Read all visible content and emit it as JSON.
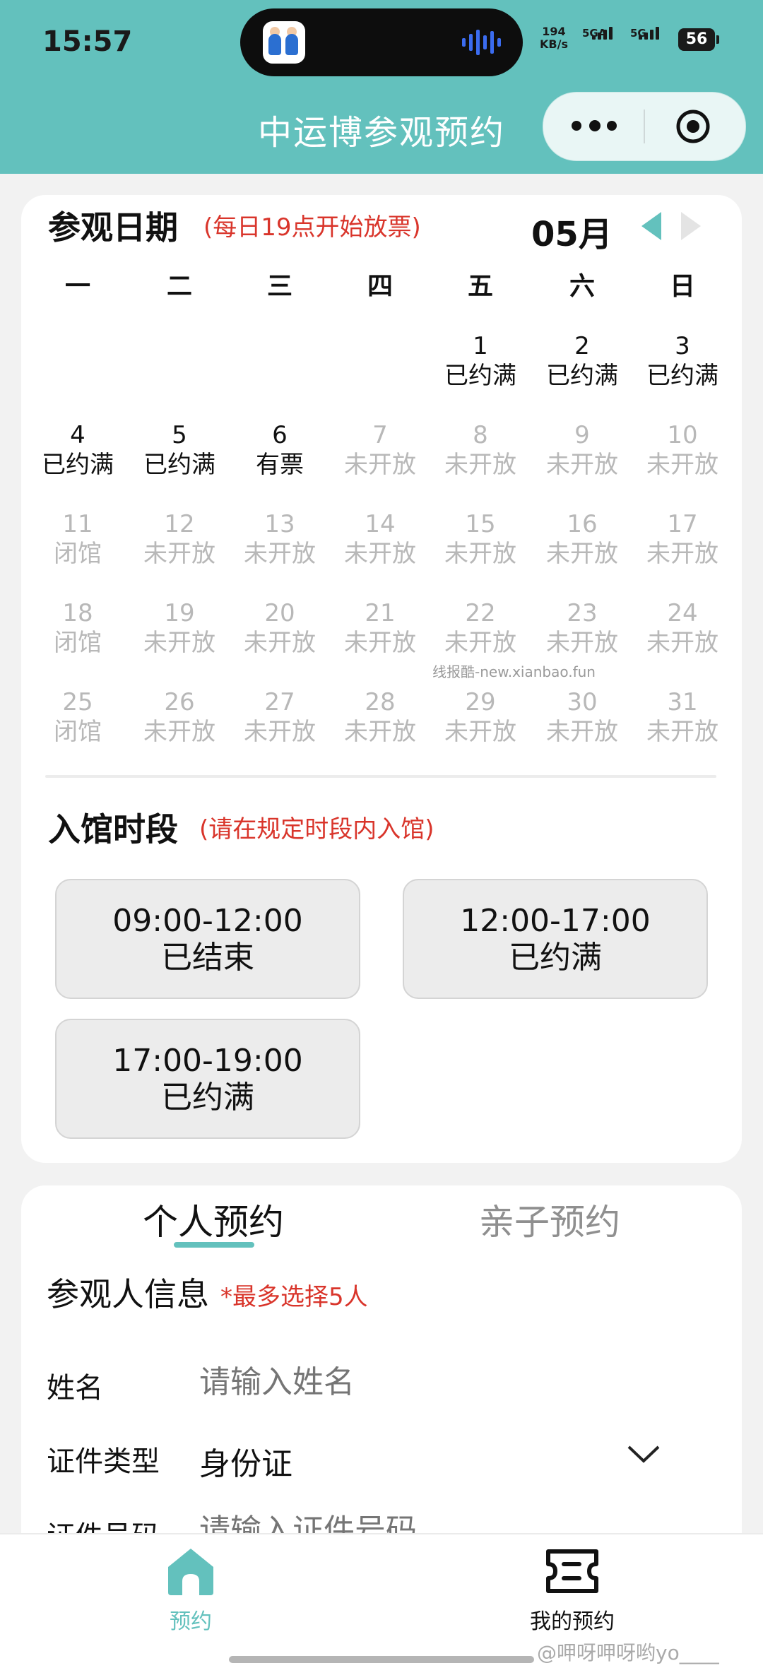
{
  "status_bar": {
    "time": "15:57",
    "net_speed_value": "194",
    "net_speed_unit": "KB/s",
    "sim1": "5GA",
    "sim2": "5G",
    "battery": "56"
  },
  "header": {
    "title": "中运博参观预约"
  },
  "date_section": {
    "title": "参观日期",
    "note": "(每日19点开始放票)",
    "month": "05月",
    "weekdays": [
      "一",
      "二",
      "三",
      "四",
      "五",
      "六",
      "日"
    ],
    "days": [
      {
        "day": "1",
        "status": "已约满"
      },
      {
        "day": "2",
        "status": "已约满"
      },
      {
        "day": "3",
        "status": "已约满"
      },
      {
        "day": "4",
        "status": "已约满"
      },
      {
        "day": "5",
        "status": "已约满"
      },
      {
        "day": "6",
        "status": "有票"
      },
      {
        "day": "7",
        "status": "未开放"
      },
      {
        "day": "8",
        "status": "未开放"
      },
      {
        "day": "9",
        "status": "未开放"
      },
      {
        "day": "10",
        "status": "未开放"
      },
      {
        "day": "11",
        "status": "闭馆"
      },
      {
        "day": "12",
        "status": "未开放"
      },
      {
        "day": "13",
        "status": "未开放"
      },
      {
        "day": "14",
        "status": "未开放"
      },
      {
        "day": "15",
        "status": "未开放"
      },
      {
        "day": "16",
        "status": "未开放"
      },
      {
        "day": "17",
        "status": "未开放"
      },
      {
        "day": "18",
        "status": "闭馆"
      },
      {
        "day": "19",
        "status": "未开放"
      },
      {
        "day": "20",
        "status": "未开放"
      },
      {
        "day": "21",
        "status": "未开放"
      },
      {
        "day": "22",
        "status": "未开放"
      },
      {
        "day": "23",
        "status": "未开放"
      },
      {
        "day": "24",
        "status": "未开放"
      },
      {
        "day": "25",
        "status": "闭馆"
      },
      {
        "day": "26",
        "status": "未开放"
      },
      {
        "day": "27",
        "status": "未开放"
      },
      {
        "day": "28",
        "status": "未开放"
      },
      {
        "day": "29",
        "status": "未开放"
      },
      {
        "day": "30",
        "status": "未开放"
      },
      {
        "day": "31",
        "status": "未开放"
      }
    ],
    "watermark": "线报酷-new.xianbao.fun"
  },
  "time_section": {
    "title": "入馆时段",
    "note": "(请在规定时段内入馆)",
    "slots": [
      {
        "time": "09:00-12:00",
        "status": "已结束"
      },
      {
        "time": "12:00-17:00",
        "status": "已约满"
      },
      {
        "time": "17:00-19:00",
        "status": "已约满"
      }
    ]
  },
  "booking": {
    "tabs": [
      "个人预约",
      "亲子预约"
    ],
    "visitor_title": "参观人信息",
    "visitor_note": "*最多选择5人",
    "name_label": "姓名",
    "name_placeholder": "请输入姓名",
    "id_type_label": "证件类型",
    "id_type_value": "身份证",
    "id_number_label": "证件号码",
    "id_number_placeholder": "请输入证件号码"
  },
  "tabbar": {
    "home_label": "预约",
    "mine_label": "我的预约"
  },
  "weibo_watermark": "@呷呀呷呀哟yo____",
  "colors": {
    "brand": "#63c1bd",
    "note_red": "#d9352b",
    "disabled": "#b8b8b8"
  }
}
